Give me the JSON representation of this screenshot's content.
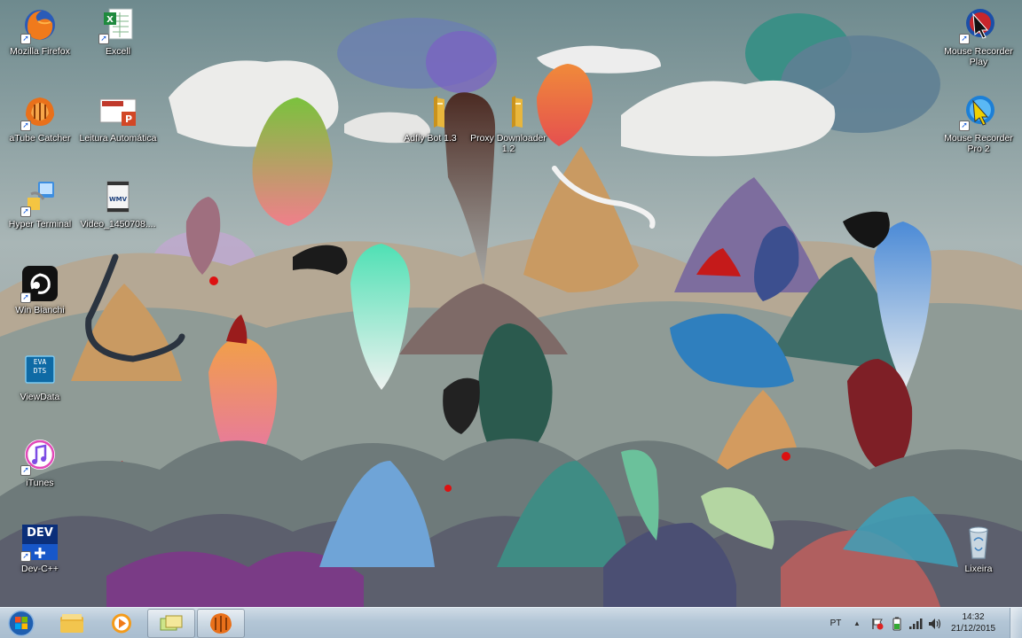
{
  "desktop": {
    "icons_left": [
      {
        "label": "Mozilla Firefox",
        "icon": "firefox-icon"
      },
      {
        "label": "aTube Catcher",
        "icon": "atube-catcher-icon"
      },
      {
        "label": "Hyper Terminal",
        "icon": "hyper-terminal-icon"
      },
      {
        "label": "Win Bianchi",
        "icon": "win-bianchi-icon"
      },
      {
        "label": "ViewData",
        "icon": "viewdata-icon"
      },
      {
        "label": "iTunes",
        "icon": "itunes-icon"
      },
      {
        "label": "Dev-C++",
        "icon": "devcpp-icon",
        "badge": "DEV"
      }
    ],
    "icons_col2": [
      {
        "label": "Excell",
        "icon": "excel-icon"
      },
      {
        "label": "Leitura Automática",
        "icon": "powerpoint-icon"
      },
      {
        "label": "Video_1450708....",
        "icon": "wmv-video-icon",
        "badge": "WMV"
      }
    ],
    "icons_mid": [
      {
        "label": "Adfly Bot 1.3",
        "icon": "folder-icon"
      },
      {
        "label": "Proxy Downloader 1.2",
        "icon": "folder-icon"
      }
    ],
    "icons_right": [
      {
        "label": "Mouse Recorder Play",
        "icon": "mouse-recorder-play-icon"
      },
      {
        "label": "Mouse Recorder Pro 2",
        "icon": "mouse-recorder-pro-icon"
      },
      {
        "label": "Lixeira",
        "icon": "recycle-bin-icon"
      }
    ],
    "viewdata_badge": "EVA DTS"
  },
  "taskbar": {
    "start": {
      "icon": "windows-start-icon"
    },
    "pinned": [
      {
        "name": "explorer",
        "icon": "folder-library-icon"
      },
      {
        "name": "media-player",
        "icon": "media-player-icon"
      },
      {
        "name": "window-switcher",
        "icon": "window-switcher-icon",
        "active": true
      },
      {
        "name": "atube-catcher",
        "icon": "atube-catcher-icon",
        "active": true
      }
    ],
    "tray": {
      "language": "PT",
      "time": "14:32",
      "date": "21/12/2015"
    }
  },
  "colors": {
    "taskbar_top": "#cfdbe6",
    "taskbar_bottom": "#a9bdcf",
    "label_text": "#ffffff"
  }
}
